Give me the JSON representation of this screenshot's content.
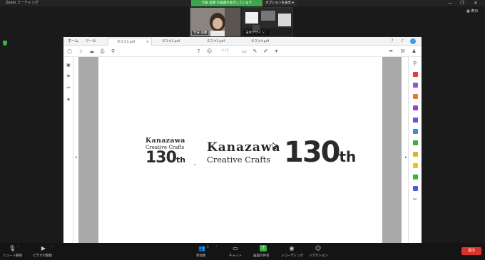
{
  "app": {
    "title": "Zoom ミーティング",
    "window_controls": [
      "—",
      "❐",
      "✕"
    ],
    "view_button": "表示",
    "share_banner": {
      "status": "竹安 美穂 の画面を表示しています",
      "options": "オプションを表示 ▾"
    }
  },
  "participants": [
    {
      "name": "竹安 美穂"
    },
    {
      "name": "玉木デザイン..."
    }
  ],
  "acrobat": {
    "nav": [
      "ホーム",
      "ツール"
    ],
    "tabs": [
      {
        "label": "タスク1.pdf",
        "active": true
      },
      {
        "label": "タスク2.pdf",
        "active": false
      },
      {
        "label": "タスク3.pdf",
        "active": false
      },
      {
        "label": "タスク4.pdf",
        "active": false
      }
    ],
    "page_indicator": "1 / 1"
  },
  "document": {
    "logo_small": {
      "line1": "Kanazawa",
      "line2": "Creative Crafts",
      "number": "130",
      "suffix": "th"
    },
    "logo_large": {
      "line1": "Kanazawa",
      "line2": "Creative Crafts",
      "number": "130",
      "suffix": "th"
    }
  },
  "bottom_bar": {
    "mute": "ミュート解除",
    "video": "ビデオの開始",
    "participants": "参加者",
    "participants_count": "1",
    "chat": "チャット",
    "share": "画面の共有",
    "record": "レコーディング",
    "reactions": "リアクション",
    "leave": "退出"
  },
  "colors": {
    "share_green": "#40a34d",
    "leave_red": "#d9342b",
    "acrobat_blue": "#3aa0e0"
  }
}
